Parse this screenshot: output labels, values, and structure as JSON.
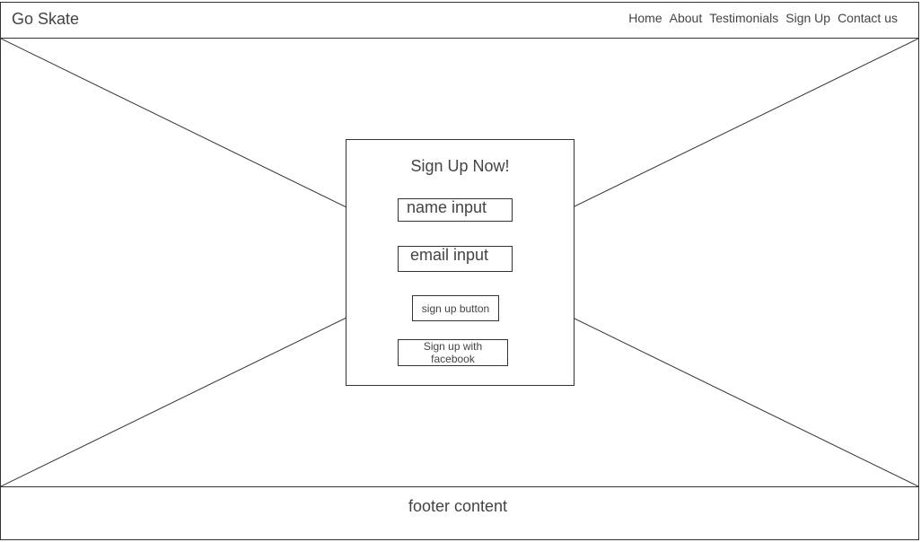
{
  "header": {
    "brand": "Go Skate",
    "nav": [
      "Home",
      "About",
      "Testimonials",
      "Sign Up",
      "Contact us"
    ]
  },
  "signup": {
    "title": "Sign Up Now!",
    "name_input": "name input",
    "email_input": "email input",
    "signup_button": "sign up button",
    "facebook_button": "Sign up with facebook"
  },
  "footer": {
    "text": "footer content"
  },
  "colors": {
    "border": "#333333",
    "text": "#444444",
    "background": "#ffffff"
  }
}
